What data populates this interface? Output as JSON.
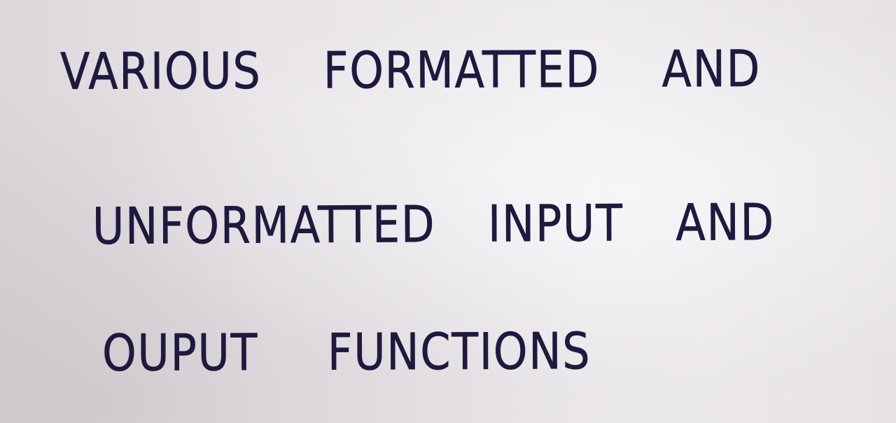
{
  "note": {
    "lines": [
      "VARIOUS FORMATTED AND",
      "UNFORMATTED INPUT AND",
      "OUPUT FUNCTIONS"
    ],
    "ink_color": "#1d1a3e",
    "paper_color": "#e8e4e8"
  }
}
